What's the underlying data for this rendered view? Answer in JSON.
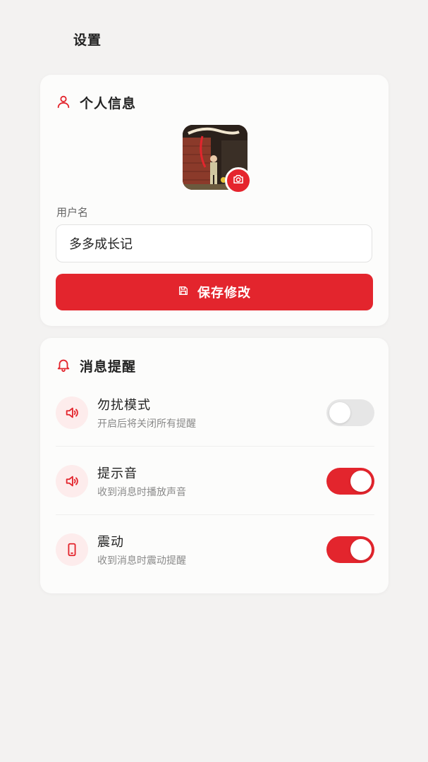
{
  "header": {
    "title": "设置"
  },
  "profile": {
    "section_title": "个人信息",
    "section_icon": "user-icon",
    "avatar_camera_icon": "camera-icon",
    "username_label": "用户名",
    "username_value": "多多成长记",
    "save_icon": "save-icon",
    "save_label": "保存修改"
  },
  "notifications": {
    "section_title": "消息提醒",
    "section_icon": "bell-icon",
    "items": [
      {
        "title": "勿扰模式",
        "subtitle": "开启后将关闭所有提醒",
        "icon": "speaker-icon",
        "enabled": false
      },
      {
        "title": "提示音",
        "subtitle": "收到消息时播放声音",
        "icon": "speaker-icon",
        "enabled": true
      },
      {
        "title": "震动",
        "subtitle": "收到消息时震动提醒",
        "icon": "phone-icon",
        "enabled": true
      }
    ]
  },
  "colors": {
    "accent": "#e3252d",
    "background": "#f3f2f1",
    "card": "#fcfcfb"
  }
}
